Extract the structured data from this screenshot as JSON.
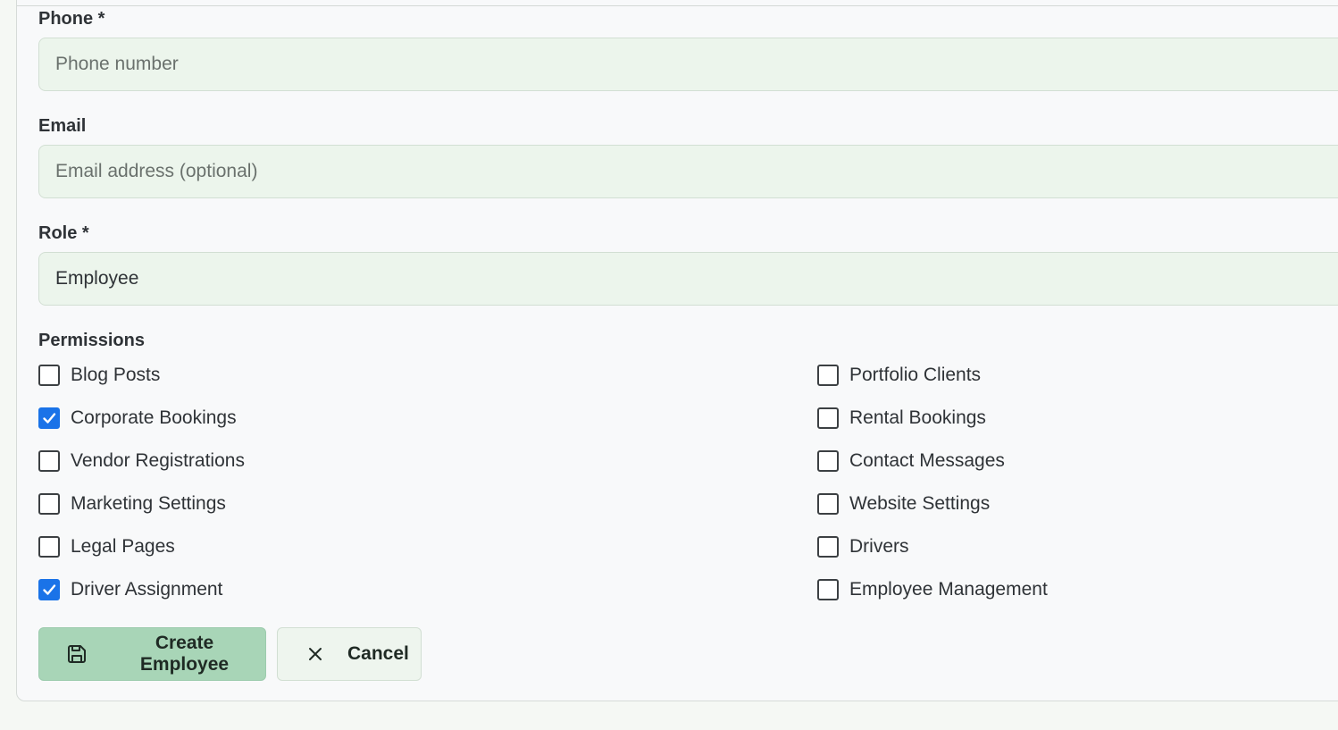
{
  "form": {
    "phone": {
      "label": "Phone *",
      "placeholder": "Phone number",
      "value": ""
    },
    "email": {
      "label": "Email",
      "placeholder": "Email address (optional)",
      "value": ""
    },
    "role": {
      "label": "Role *",
      "value": "Employee"
    },
    "permissions": {
      "label": "Permissions",
      "left": [
        {
          "label": "Blog Posts",
          "checked": false
        },
        {
          "label": "Corporate Bookings",
          "checked": true
        },
        {
          "label": "Vendor Registrations",
          "checked": false
        },
        {
          "label": "Marketing Settings",
          "checked": false
        },
        {
          "label": "Legal Pages",
          "checked": false
        },
        {
          "label": "Driver Assignment",
          "checked": true
        }
      ],
      "right": [
        {
          "label": "Portfolio Clients",
          "checked": false
        },
        {
          "label": "Rental Bookings",
          "checked": false
        },
        {
          "label": "Contact Messages",
          "checked": false
        },
        {
          "label": "Website Settings",
          "checked": false
        },
        {
          "label": "Drivers",
          "checked": false
        },
        {
          "label": "Employee Management",
          "checked": false
        }
      ]
    },
    "actions": {
      "create_label": "Create Employee",
      "create_icon": "save-icon",
      "cancel_label": "Cancel",
      "cancel_icon": "close-icon"
    }
  },
  "colors": {
    "input_background": "#ecf5ec",
    "primary_button": "#a8d5b7",
    "checkbox_checked": "#1a73e8"
  }
}
